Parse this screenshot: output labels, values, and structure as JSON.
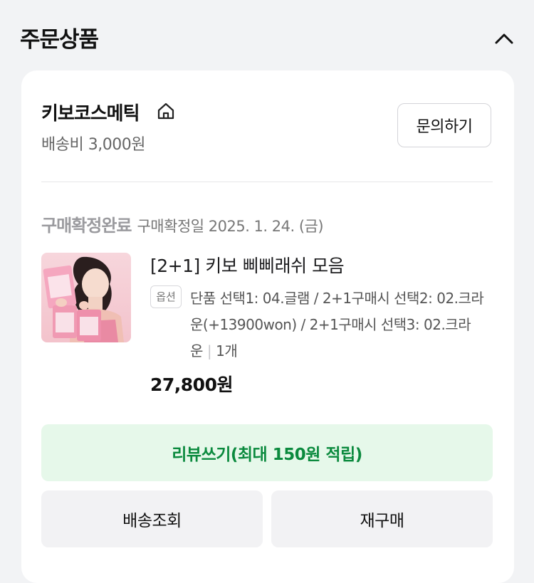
{
  "section": {
    "title": "주문상품"
  },
  "seller": {
    "name": "키보코스메틱",
    "shipping_fee": "배송비 3,000원",
    "inquiry_label": "문의하기"
  },
  "order": {
    "status": "구매확정완료",
    "confirm_date": "구매확정일 2025. 1. 24. (금)",
    "product_name": "[2+1] 키보 삐삐래쉬 모음",
    "option_badge": "옵션",
    "option_text": "단품 선택1: 04.글램 / 2+1구매시 선택2: 02.크라운(+13900won) / 2+1구매시 선택3: 02.크라운",
    "quantity": "1개",
    "price": "27,800원"
  },
  "actions": {
    "review": "리뷰쓰기(최대 150원 적립)",
    "track": "배송조회",
    "reorder": "재구매"
  },
  "colors": {
    "accent_green": "#0b8a3e",
    "review_bg": "#e6f8ea",
    "page_bg": "#f2f3f5"
  }
}
